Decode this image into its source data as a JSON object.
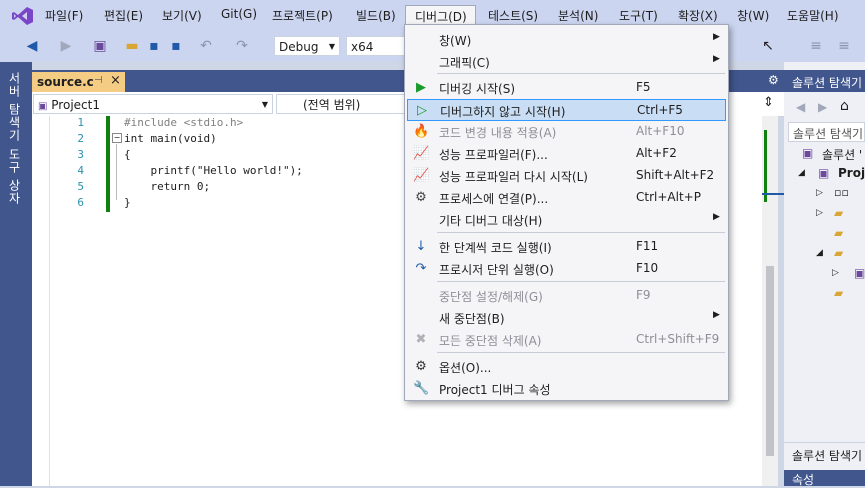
{
  "menubar": {
    "items": [
      "파일(F)",
      "편집(E)",
      "보기(V)",
      "Git(G)",
      "프로젝트(P)",
      "빌드(B)",
      "디버그(D)",
      "테스트(S)",
      "분석(N)",
      "도구(T)",
      "확장(X)",
      "창(W)",
      "도움말(H)"
    ]
  },
  "toolbar": {
    "config": "Debug",
    "platform": "x64"
  },
  "left_tabs": [
    "서버 탐색기",
    "도구 상자"
  ],
  "editor": {
    "tab_title": "source.c",
    "project_combo": "Project1",
    "scope_combo": "(전역 범위)",
    "line_numbers": [
      "1",
      "2",
      "3",
      "4",
      "5",
      "6"
    ],
    "lines": [
      "#include <stdio.h>",
      "int main(void)",
      "{",
      "    printf(\"Hello world!\");",
      "    return 0;",
      "}"
    ]
  },
  "solution_explorer": {
    "title": "솔루션 탐색기",
    "search_placeholder": "솔루션 탐색기",
    "root": "솔루션 '",
    "project": "Proje",
    "bottom_tab": "솔루션 탐색기",
    "bottom_title": "속성"
  },
  "debug_menu": {
    "items": [
      {
        "label": "창(W)",
        "shortcut": "",
        "submenu": true,
        "icon": "",
        "disabled": false
      },
      {
        "label": "그래픽(C)",
        "shortcut": "",
        "submenu": true,
        "icon": "",
        "disabled": false
      },
      {
        "label": "디버깅 시작(S)",
        "shortcut": "F5",
        "submenu": false,
        "icon": "play-icon",
        "disabled": false
      },
      {
        "label": "디버그하지 않고 시작(H)",
        "shortcut": "Ctrl+F5",
        "submenu": false,
        "icon": "play-outline-icon",
        "disabled": false
      },
      {
        "label": "코드 변경 내용 적용(A)",
        "shortcut": "Alt+F10",
        "submenu": false,
        "icon": "apply-changes-icon",
        "disabled": true
      },
      {
        "label": "성능 프로파일러(F)...",
        "shortcut": "Alt+F2",
        "submenu": false,
        "icon": "profiler-icon",
        "disabled": false
      },
      {
        "label": "성능 프로파일러 다시 시작(L)",
        "shortcut": "Shift+Alt+F2",
        "submenu": false,
        "icon": "profiler-icon",
        "disabled": false
      },
      {
        "label": "프로세스에 연결(P)...",
        "shortcut": "Ctrl+Alt+P",
        "submenu": false,
        "icon": "attach-process-icon",
        "disabled": false
      },
      {
        "label": "기타 디버그 대상(H)",
        "shortcut": "",
        "submenu": true,
        "icon": "",
        "disabled": false
      },
      {
        "label": "한 단계씩 코드 실행(I)",
        "shortcut": "F11",
        "submenu": false,
        "icon": "step-into-icon",
        "disabled": false
      },
      {
        "label": "프로시저 단위 실행(O)",
        "shortcut": "F10",
        "submenu": false,
        "icon": "step-over-icon",
        "disabled": false
      },
      {
        "label": "중단점 설정/해제(G)",
        "shortcut": "F9",
        "submenu": false,
        "icon": "",
        "disabled": true
      },
      {
        "label": "새 중단점(B)",
        "shortcut": "",
        "submenu": true,
        "icon": "",
        "disabled": false
      },
      {
        "label": "모든 중단점 삭제(A)",
        "shortcut": "Ctrl+Shift+F9",
        "submenu": false,
        "icon": "delete-breakpoints-icon",
        "disabled": true
      },
      {
        "label": "옵션(O)...",
        "shortcut": "",
        "submenu": false,
        "icon": "gear-icon",
        "disabled": false
      },
      {
        "label": "Project1 디버그 속성",
        "shortcut": "",
        "submenu": false,
        "icon": "wrench-icon",
        "disabled": false
      }
    ]
  },
  "colors": {
    "accent": "#3399ff",
    "chrome": "#ccd5f0",
    "side_dark": "#40568d",
    "active_tab": "#f5cc84",
    "change_bar": "#108010"
  }
}
